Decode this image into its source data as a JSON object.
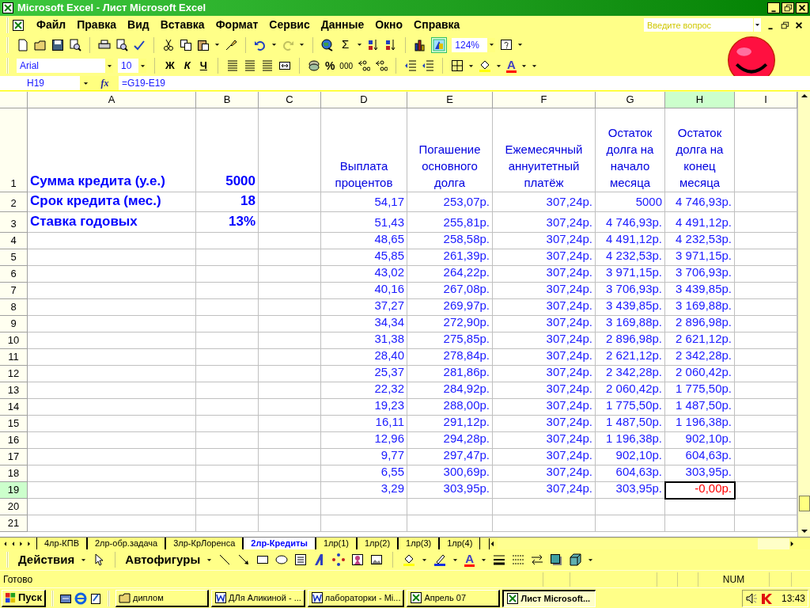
{
  "window": {
    "title": "Microsoft Excel - Лист Microsoft Excel"
  },
  "menu": [
    "Файл",
    "Правка",
    "Вид",
    "Вставка",
    "Формат",
    "Сервис",
    "Данные",
    "Окно",
    "Справка"
  ],
  "help_field": {
    "placeholder": "Введите вопрос"
  },
  "standard_toolbar": {
    "sum_label": "Σ",
    "zoom": "124%"
  },
  "format_toolbar": {
    "font": "Arial",
    "size": "10",
    "style_buttons": [
      {
        "label": "Ж",
        "kind": "bold"
      },
      {
        "label": "К",
        "kind": "italic"
      },
      {
        "label": "Ч",
        "kind": "underline"
      }
    ],
    "percent": "%",
    "thousands": "000",
    "font_color_label": "A"
  },
  "formula_bar": {
    "name_box": "H19",
    "fx": "fx",
    "formula": "=G19-E19"
  },
  "columns": [
    {
      "label": "A",
      "selected": false
    },
    {
      "label": "B",
      "selected": false
    },
    {
      "label": "C",
      "selected": false
    },
    {
      "label": "D",
      "selected": false
    },
    {
      "label": "E",
      "selected": false
    },
    {
      "label": "F",
      "selected": false
    },
    {
      "label": "G",
      "selected": false
    },
    {
      "label": "H",
      "selected": true
    },
    {
      "label": "I",
      "selected": false
    }
  ],
  "rows": [
    {
      "label": "1",
      "selected": false,
      "kind": "heading",
      "cells": [
        "Сумма кредита (у.е.)",
        "5000",
        null,
        "Выплата процентов",
        "Погашение основного долга",
        "Ежемесячный аннуитетный платёж",
        "Остаток долга на начало месяца",
        "Остаток долга на конец месяца",
        null
      ]
    },
    {
      "label": "2",
      "selected": false,
      "kind": "data",
      "cells": [
        "Срок кредита (мес.)",
        "18",
        null,
        "54,17",
        "253,07р.",
        "307,24р.",
        "5000",
        "4 746,93р.",
        null
      ]
    },
    {
      "label": "3",
      "selected": false,
      "kind": "data",
      "cells": [
        "Ставка годовых",
        "13%",
        null,
        "51,43",
        "255,81р.",
        "307,24р.",
        "4 746,93р.",
        "4 491,12р.",
        null
      ]
    },
    {
      "label": "4",
      "selected": false,
      "kind": "data",
      "cells": [
        null,
        null,
        null,
        "48,65",
        "258,58р.",
        "307,24р.",
        "4 491,12р.",
        "4 232,53р.",
        null
      ]
    },
    {
      "label": "5",
      "selected": false,
      "kind": "data",
      "cells": [
        null,
        null,
        null,
        "45,85",
        "261,39р.",
        "307,24р.",
        "4 232,53р.",
        "3 971,15р.",
        null
      ]
    },
    {
      "label": "6",
      "selected": false,
      "kind": "data",
      "cells": [
        null,
        null,
        null,
        "43,02",
        "264,22р.",
        "307,24р.",
        "3 971,15р.",
        "3 706,93р.",
        null
      ]
    },
    {
      "label": "7",
      "selected": false,
      "kind": "data",
      "cells": [
        null,
        null,
        null,
        "40,16",
        "267,08р.",
        "307,24р.",
        "3 706,93р.",
        "3 439,85р.",
        null
      ]
    },
    {
      "label": "8",
      "selected": false,
      "kind": "data",
      "cells": [
        null,
        null,
        null,
        "37,27",
        "269,97р.",
        "307,24р.",
        "3 439,85р.",
        "3 169,88р.",
        null
      ]
    },
    {
      "label": "9",
      "selected": false,
      "kind": "data",
      "cells": [
        null,
        null,
        null,
        "34,34",
        "272,90р.",
        "307,24р.",
        "3 169,88р.",
        "2 896,98р.",
        null
      ]
    },
    {
      "label": "10",
      "selected": false,
      "kind": "data",
      "cells": [
        null,
        null,
        null,
        "31,38",
        "275,85р.",
        "307,24р.",
        "2 896,98р.",
        "2 621,12р.",
        null
      ]
    },
    {
      "label": "11",
      "selected": false,
      "kind": "data",
      "cells": [
        null,
        null,
        null,
        "28,40",
        "278,84р.",
        "307,24р.",
        "2 621,12р.",
        "2 342,28р.",
        null
      ]
    },
    {
      "label": "12",
      "selected": false,
      "kind": "data",
      "cells": [
        null,
        null,
        null,
        "25,37",
        "281,86р.",
        "307,24р.",
        "2 342,28р.",
        "2 060,42р.",
        null
      ]
    },
    {
      "label": "13",
      "selected": false,
      "kind": "data",
      "cells": [
        null,
        null,
        null,
        "22,32",
        "284,92р.",
        "307,24р.",
        "2 060,42р.",
        "1 775,50р.",
        null
      ]
    },
    {
      "label": "14",
      "selected": false,
      "kind": "data",
      "cells": [
        null,
        null,
        null,
        "19,23",
        "288,00р.",
        "307,24р.",
        "1 775,50р.",
        "1 487,50р.",
        null
      ]
    },
    {
      "label": "15",
      "selected": false,
      "kind": "data",
      "cells": [
        null,
        null,
        null,
        "16,11",
        "291,12р.",
        "307,24р.",
        "1 487,50р.",
        "1 196,38р.",
        null
      ]
    },
    {
      "label": "16",
      "selected": false,
      "kind": "data",
      "cells": [
        null,
        null,
        null,
        "12,96",
        "294,28р.",
        "307,24р.",
        "1 196,38р.",
        "902,10р.",
        null
      ]
    },
    {
      "label": "17",
      "selected": false,
      "kind": "data",
      "cells": [
        null,
        null,
        null,
        "9,77",
        "297,47р.",
        "307,24р.",
        "902,10р.",
        "604,63р.",
        null
      ]
    },
    {
      "label": "18",
      "selected": false,
      "kind": "data",
      "cells": [
        null,
        null,
        null,
        "6,55",
        "300,69р.",
        "307,24р.",
        "604,63р.",
        "303,95р.",
        null
      ]
    },
    {
      "label": "19",
      "selected": true,
      "kind": "data",
      "cells": [
        null,
        null,
        null,
        "3,29",
        "303,95р.",
        "307,24р.",
        "303,95р.",
        {
          "text": "-0,00р.",
          "negative": true
        },
        null
      ]
    },
    {
      "label": "20",
      "selected": false,
      "kind": "data",
      "cells": [
        null,
        null,
        null,
        null,
        null,
        null,
        null,
        null,
        null
      ]
    },
    {
      "label": "21",
      "selected": false,
      "kind": "data",
      "cells": [
        null,
        null,
        null,
        null,
        null,
        null,
        null,
        null,
        null
      ]
    }
  ],
  "sheet_tabs": [
    {
      "label": "4лр-КПВ",
      "selected": false
    },
    {
      "label": "2лр-обр.задача",
      "selected": false
    },
    {
      "label": "3лр-КрЛоренса",
      "selected": false
    },
    {
      "label": "2лр-Кредиты",
      "selected": true
    },
    {
      "label": "1лр(1)",
      "selected": false
    },
    {
      "label": "1лр(2)",
      "selected": false
    },
    {
      "label": "1лр(3)",
      "selected": false
    },
    {
      "label": "1лр(4)",
      "selected": false
    }
  ],
  "drawing_toolbar": {
    "actions": "Действия",
    "autoshapes": "Автофигуры",
    "font_color_label": "A"
  },
  "status_bar": {
    "status": "Готово",
    "num": "NUM"
  },
  "taskbar": {
    "start": "Пуск",
    "tasks": [
      {
        "label": "диплом",
        "kind": "folder",
        "selected": false
      },
      {
        "label": "ДЛя Аликиной - ...",
        "kind": "word",
        "selected": false
      },
      {
        "label": "лабораторки - Mi...",
        "kind": "word",
        "selected": false
      },
      {
        "label": "Апрель 07",
        "kind": "excel",
        "selected": false
      },
      {
        "label": "Лист Microsoft...",
        "kind": "excel",
        "selected": true
      }
    ],
    "clock": "13:43"
  }
}
